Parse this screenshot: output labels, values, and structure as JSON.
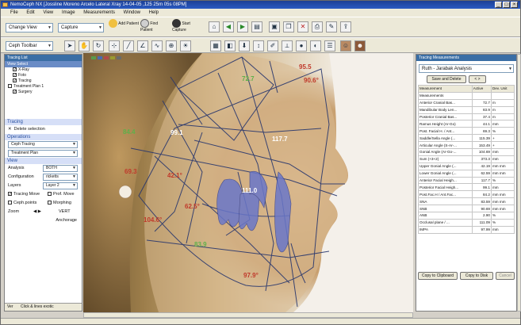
{
  "window": {
    "title": "NemoCeph NX   [Jossline Moreno Arcelo   Lateral Xray 14-04-05 ,125 25m 05s 08PM]"
  },
  "menu": [
    "File",
    "Edit",
    "View",
    "Image",
    "Measurements",
    "Window",
    "Help"
  ],
  "toolbar": {
    "change_view": "Change View",
    "capture": "Capture",
    "add_patient": "Add Patient",
    "find_patient": "Find Patient",
    "start_capture": "Start Capture",
    "ceph_toolbar": "Ceph Toolbar"
  },
  "left_panel": {
    "title": "Tracing List",
    "views_title": "View Select",
    "tree": [
      {
        "label": "X-Ray",
        "checked": true,
        "indent": 1
      },
      {
        "label": "Foto",
        "checked": true,
        "indent": 1
      },
      {
        "label": "Tracing",
        "checked": true,
        "indent": 1
      },
      {
        "label": "Treatment Plan 1",
        "checked": false,
        "indent": 0
      },
      {
        "label": "Surgery",
        "checked": true,
        "indent": 1
      }
    ],
    "tracing_section": "Tracing",
    "delete_selection": "Delete selection",
    "operations_section": "Operations",
    "ceph_tracing": "Ceph Tracing",
    "treatment_plan": "Treatment Plan",
    "view_section": "View",
    "analysis_label": "Analysis",
    "analysis_value": "BOTH",
    "configuration_label": "Configuration",
    "configuration_value": "ricketts",
    "layers_label": "Layers",
    "layers_value": "Layer 2",
    "tracing_move": "Tracing Move",
    "prof_move": "Prof. Move",
    "cephalometric_points": "Ceph.points",
    "morphing": "Morphing",
    "zoom_label": "Zoom",
    "vert_label": "VERT",
    "anchorage_label": "Anchorage",
    "status_left": "Ver",
    "status_right": "Click & lines exotic"
  },
  "measurements": [
    {
      "label": "69.3",
      "color": "#c0392b"
    },
    {
      "label": "42.1°",
      "color": "#c0392b"
    },
    {
      "label": "62.5°",
      "color": "#c0392b"
    },
    {
      "label": "104.6°",
      "color": "#c0392b"
    },
    {
      "label": "99.1",
      "color": "#ffffff"
    },
    {
      "label": "117.7",
      "color": "#ffffff"
    },
    {
      "label": "111.0",
      "color": "#ffffff"
    },
    {
      "label": "83.9",
      "color": "#5fb04a"
    },
    {
      "label": "72.7",
      "color": "#5fb04a"
    },
    {
      "label": "84.4",
      "color": "#5fb04a"
    },
    {
      "label": "90.6°",
      "color": "#c0392b"
    },
    {
      "label": "95.5",
      "color": "#c0392b"
    },
    {
      "label": "97.9°",
      "color": "#c0392b"
    }
  ],
  "right_panel": {
    "title": "Tracing Measurements",
    "analysis_select": "Ruth - Jarabak Analysis",
    "save_delete": "Save and Delete",
    "columns": [
      "Measurement",
      "Active",
      "Dev. Unit"
    ],
    "rows": [
      [
        "Measurements",
        "",
        ""
      ],
      [
        "Anterior Cranial Bas...",
        "72.7",
        "m"
      ],
      [
        "Mandibular Body Len...",
        "83.9",
        "m"
      ],
      [
        "Posterior Cranial Bas...",
        "37.4",
        "m"
      ],
      [
        "Ramus Height (Ar-Go)",
        "44.1",
        "mm"
      ],
      [
        "Post. Facial H. / Ant...",
        "69.3",
        "%"
      ],
      [
        "Saddle/Sella Angle (...",
        "115.39",
        "+"
      ],
      [
        "Articular Angle (S-Ar-...",
        "153.49",
        "+"
      ],
      [
        "Gonial Angle (Ar-Go-...",
        "104.69",
        "mm"
      ],
      [
        "Sum (+3+2)",
        "373.3",
        "mm"
      ],
      [
        "Upper Gonial Angle (...",
        "42.19",
        "mm mm"
      ],
      [
        "Lower Gonial Angle (...",
        "62.59",
        "mm mm"
      ],
      [
        "Anterior Facial Heigh...",
        "117.7",
        "%"
      ],
      [
        "Posterior Facial Heigh...",
        "99.1",
        "mm"
      ],
      [
        "Post.Fac.H / Ant.Fac...",
        "84.2",
        "mm mm"
      ],
      [
        "SNA",
        "83.59",
        "mm mm"
      ],
      [
        "SNB",
        "90.69",
        "mm mm"
      ],
      [
        "ANB",
        "2.90",
        "%"
      ],
      [
        "Occlusal plane / ...",
        "111.09",
        "%"
      ],
      [
        "IMPA",
        "97.99",
        "mm"
      ]
    ],
    "copy_clipboard": "Copy to Clipboard",
    "copy_disk": "Copy to Disk",
    "cancel": "Cancel"
  }
}
